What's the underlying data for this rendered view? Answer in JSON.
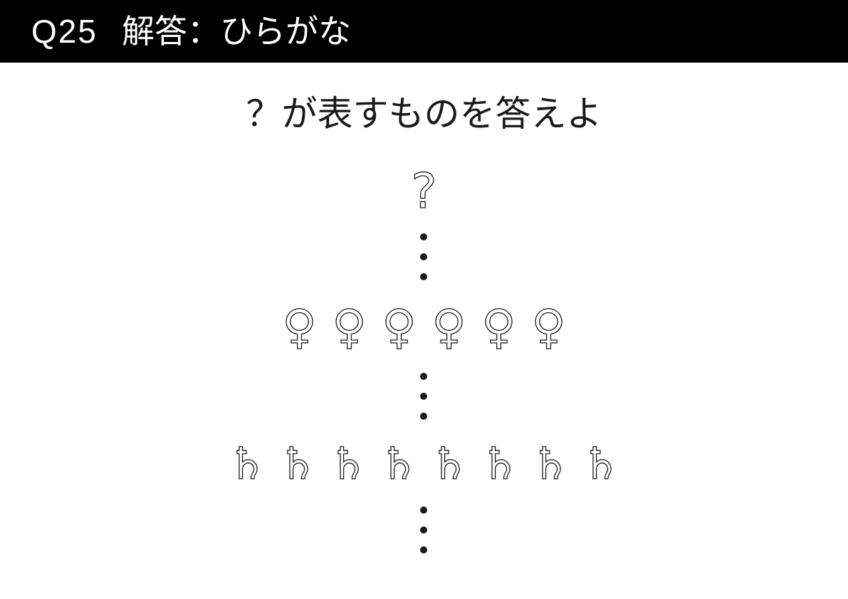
{
  "header": {
    "question_number": "Q25",
    "title": "解答：ひらがな"
  },
  "instruction": "？が表すものを答えよ",
  "puzzle": {
    "unknown_symbol": "?",
    "venus_row": [
      "♀",
      "♀",
      "♀",
      "♀",
      "♀",
      "♀"
    ],
    "saturn_row": [
      "♄",
      "♄",
      "♄",
      "♄",
      "♄",
      "♄",
      "♄",
      "♄"
    ]
  },
  "colors": {
    "header_bg": "#000000",
    "text": "#1a1a1a",
    "background": "#ffffff"
  }
}
